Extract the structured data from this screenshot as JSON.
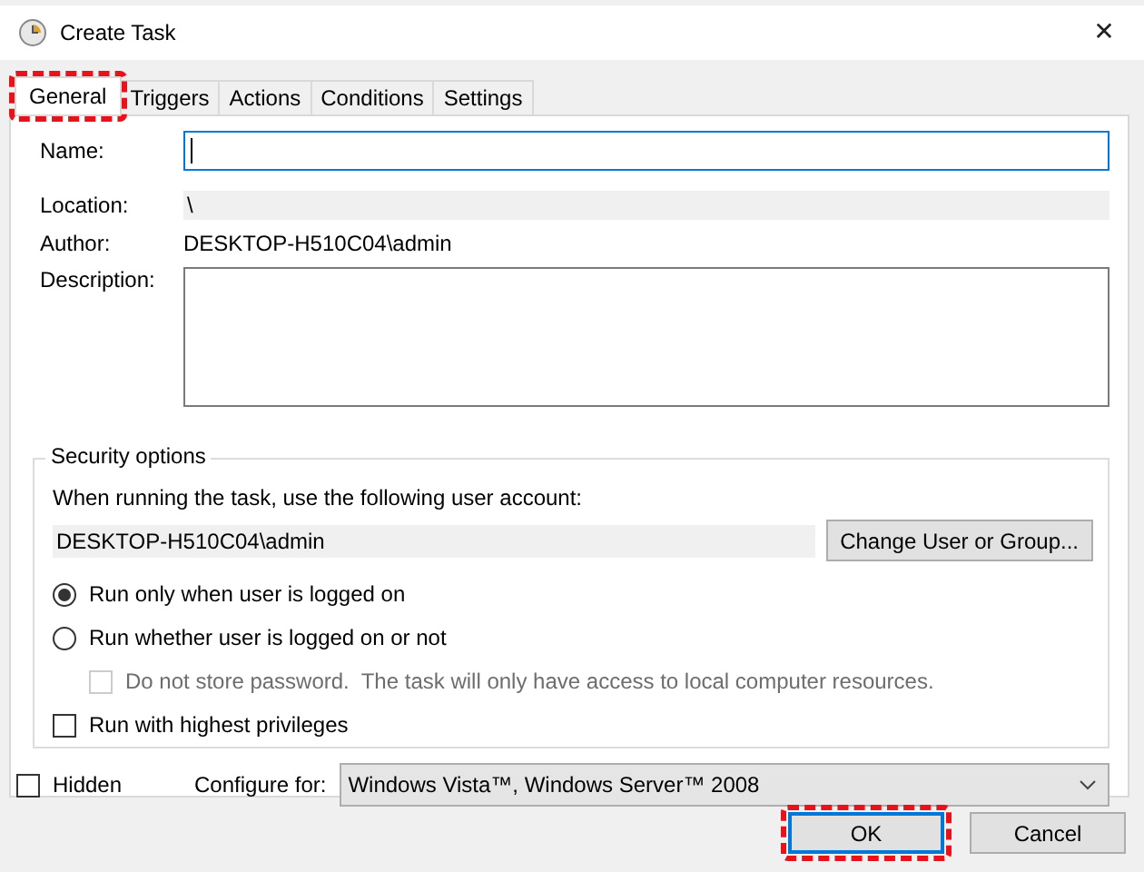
{
  "window": {
    "title": "Create Task",
    "close": "✕"
  },
  "tabs": [
    {
      "label": "General",
      "selected": true,
      "highlighted": true
    },
    {
      "label": "Triggers",
      "selected": false,
      "highlighted": false
    },
    {
      "label": "Actions",
      "selected": false,
      "highlighted": false
    },
    {
      "label": "Conditions",
      "selected": false,
      "highlighted": false
    },
    {
      "label": "Settings",
      "selected": false,
      "highlighted": false
    }
  ],
  "fields": [
    {
      "kind": "input",
      "label": "Name:",
      "focused": true
    },
    {
      "kind": "readonly",
      "label": "Location:",
      "value": "\\"
    },
    {
      "kind": "text",
      "label": "Author:",
      "value": "DESKTOP-H510C04\\admin"
    },
    {
      "kind": "textarea",
      "label": "Description:"
    }
  ],
  "security": {
    "title": "Security options",
    "prompt": "When running the task, use the following user account:",
    "account": "DESKTOP-H510C04\\admin",
    "change_button": "Change User or Group...",
    "options": [
      {
        "kind": "radio",
        "label": "Run only when user is logged on",
        "checked": true,
        "disabled": false
      },
      {
        "kind": "radio",
        "label": "Run whether user is logged on or not",
        "checked": false,
        "disabled": false,
        "children": [
          {
            "kind": "checkbox",
            "label": "Do not store password.  The task will only have access to local computer resources.",
            "checked": false,
            "disabled": true
          }
        ]
      },
      {
        "kind": "checkbox",
        "label": "Run with highest privileges",
        "checked": false,
        "disabled": false
      }
    ]
  },
  "hidden": {
    "label": "Hidden",
    "checked": false
  },
  "configure": {
    "label": "Configure for:",
    "value": "Windows Vista™, Windows Server™ 2008"
  },
  "buttons": [
    {
      "label": "OK",
      "default": true,
      "highlighted": true
    },
    {
      "label": "Cancel",
      "default": false,
      "highlighted": false
    }
  ]
}
